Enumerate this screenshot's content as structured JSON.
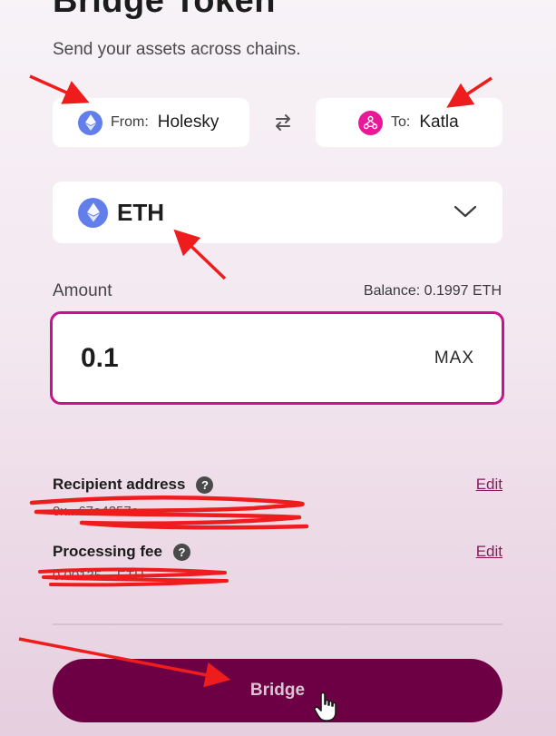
{
  "page": {
    "title": "Bridge Token",
    "subtitle": "Send your assets across chains."
  },
  "from_chain": {
    "label": "From:",
    "value": "Holesky",
    "icon": "ethereum-icon"
  },
  "to_chain": {
    "label": "To:",
    "value": "Katla",
    "icon": "taiko-icon"
  },
  "token": {
    "name": "ETH",
    "icon": "ethereum-icon"
  },
  "amount": {
    "label": "Amount",
    "balance": "Balance: 0.1997 ETH",
    "value": "0.1",
    "max_label": "MAX"
  },
  "recipient": {
    "label": "Recipient address",
    "edit_label": "Edit",
    "visible_tail": "0x...67a4357c"
  },
  "fee": {
    "label": "Processing fee",
    "edit_label": "Edit",
    "visible_tail": "0.00135... ETH"
  },
  "bridge_button": {
    "label": "Bridge"
  },
  "colors": {
    "accent": "#c8138c",
    "button": "#6d0045",
    "eth": "#627eea",
    "katla": "#e81899",
    "annotation": "#ee1c1c"
  }
}
